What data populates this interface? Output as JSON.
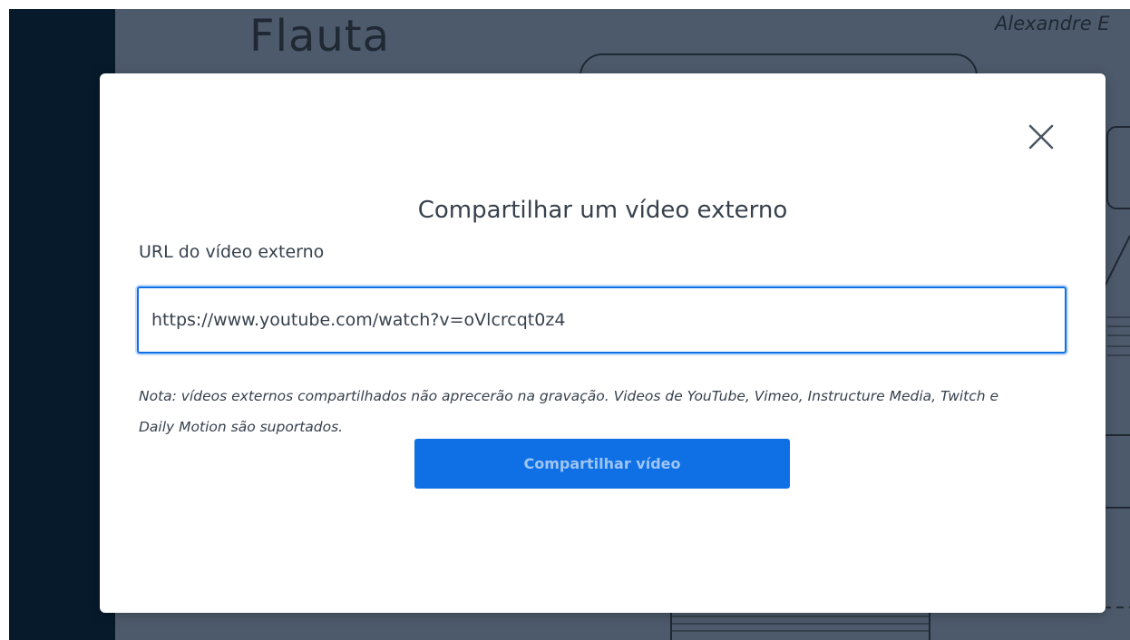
{
  "background": {
    "slide_title": "Flauta",
    "slide_author": "Alexandre E"
  },
  "modal": {
    "title": "Compartilhar um vídeo externo",
    "close_icon": "close-icon",
    "url_label": "URL do vídeo externo",
    "url_value": "https://www.youtube.com/watch?v=oVlcrcqt0z4",
    "note": "Nota: vídeos externos compartilhados não aprecerão na gravação. Videos de YouTube, Vimeo, Instructure Media, Twitch e Daily Motion são suportados.",
    "submit_label": "Compartilhar vídeo"
  },
  "colors": {
    "accent": "#0f70e6",
    "overlay": "#4d5a6b",
    "rail": "#061a2c"
  }
}
